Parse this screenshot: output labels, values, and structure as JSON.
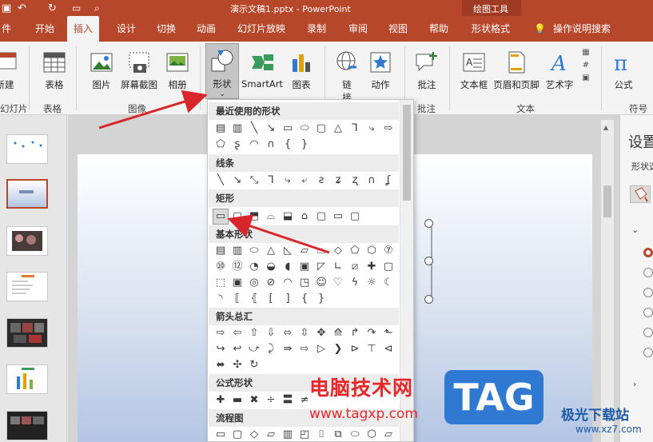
{
  "window": {
    "title": "演示文稿1.pptx  -  PowerPoint",
    "context_group": "绘图工具"
  },
  "tabs": [
    "件",
    "开始",
    "插入",
    "设计",
    "切换",
    "动画",
    "幻灯片放映",
    "录制",
    "审阅",
    "视图",
    "帮助",
    "形状格式",
    "操作说明搜索"
  ],
  "ribbon": {
    "new_slide": "新建\n幻灯片",
    "new_slide_label": "新建",
    "new_slide_group": "幻灯片",
    "table": "表格",
    "table_group": "表格",
    "picture": "图片",
    "screenshot": "屏幕截图",
    "album": "相册",
    "image_group": "图像",
    "shapes": "形状",
    "smartart": "SmartArt",
    "chart": "图表",
    "link": "链\n接",
    "link_label": "链",
    "link_label2": "接",
    "action": "动作",
    "comment": "批注",
    "comment_group": "批注",
    "textbox": "文本框",
    "header_footer": "页眉和页脚",
    "wordart": "艺术字",
    "text_group": "文本",
    "formula": "公式",
    "symbol_group": "符号"
  },
  "dropdown": {
    "sections": [
      "最近使用的形状",
      "线条",
      "矩形",
      "基本形状",
      "箭头总汇",
      "公式形状",
      "流程图"
    ]
  },
  "right_panel": {
    "title": "设置",
    "sub": "形状选"
  },
  "watermark": {
    "cn": "电脑技术网",
    "url": "www.tagxp.com",
    "tag": "TAG",
    "brand": "极光下载站",
    "brand_url": "www.xz7.com"
  },
  "colors": {
    "accent": "#b7472a",
    "arrow": "#d9262a"
  }
}
